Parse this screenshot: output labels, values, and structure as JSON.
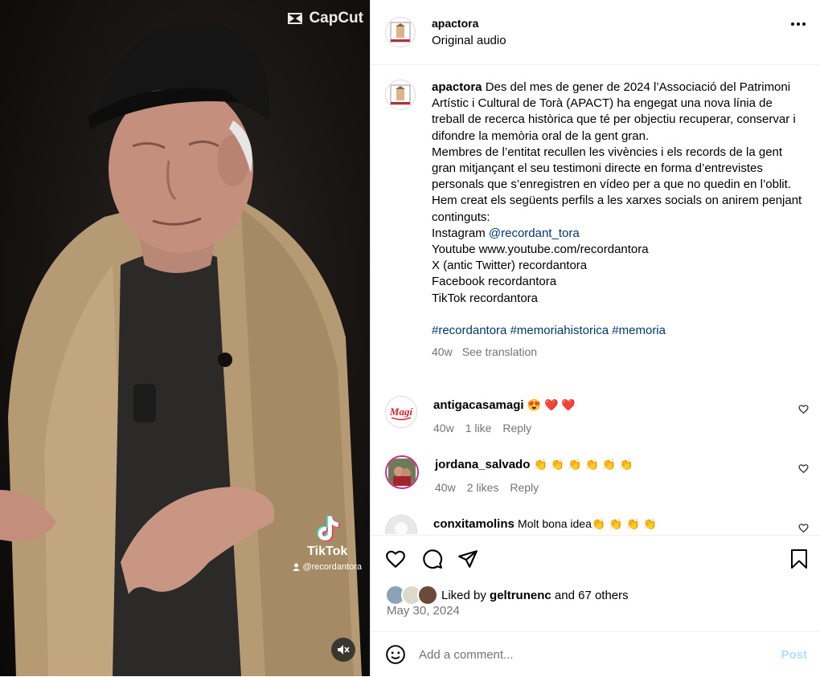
{
  "media": {
    "watermark_brand": "CapCut",
    "tiktok_label": "TikTok",
    "tiktok_user": "@recordantora",
    "mute_icon": "speaker-muted-icon"
  },
  "header": {
    "username": "apactora",
    "subtitle": "Original audio"
  },
  "caption": {
    "username": "apactora",
    "lines": [
      "Des del mes de gener de 2024 l’Associació del Patrimoni Artístic i Cultural de Torà (APACT) ha engegat una nova línia de treball de recerca històrica que té per objectiu recuperar, conservar i difondre la memòria oral de la gent gran.",
      "Membres de l’entitat recullen les vivències i els records de la gent gran mitjançant el seu testimoni directe en forma d’entrevistes personals que s’enregistren en vídeo per a que no quedin en l’oblit.",
      "Hem creat els següents perfils a les xarxes socials on anirem penjant continguts:"
    ],
    "instagram_prefix": "Instagram",
    "instagram_handle": "@recordant_tora",
    "youtube": "Youtube www.youtube.com/recordantora",
    "x": "X (antic Twitter) recordantora",
    "facebook": "Facebook recordantora",
    "tiktok": "TikTok recordantora",
    "hashtags": [
      "#recordantora",
      "#memoriahistorica",
      "#memoria"
    ],
    "age": "40w",
    "see_translation": "See translation"
  },
  "comments": [
    {
      "username": "antigacasamagi",
      "text": "😍 ❤️ ❤️",
      "age": "40w",
      "likes": "1 like",
      "reply": "Reply",
      "avatar_label": "Magí"
    },
    {
      "username": "jordana_salvado",
      "text": "👏 👏 👏 👏 👏 👏",
      "age": "40w",
      "likes": "2 likes",
      "reply": "Reply"
    },
    {
      "username": "conxitamolins",
      "text": "Molt bona idea👏 👏 👏 👏",
      "age": "",
      "likes": "",
      "reply": ""
    }
  ],
  "likes": {
    "prefix": "Liked by",
    "user": "geltrunenc",
    "suffix": "and 67 others"
  },
  "date": "May 30, 2024",
  "add_comment": {
    "placeholder": "Add a comment...",
    "post_label": "Post"
  },
  "colors": {
    "link": "#00376b",
    "muted": "#737373",
    "post_disabled": "#b2dffc",
    "border": "#dbdbdb"
  }
}
